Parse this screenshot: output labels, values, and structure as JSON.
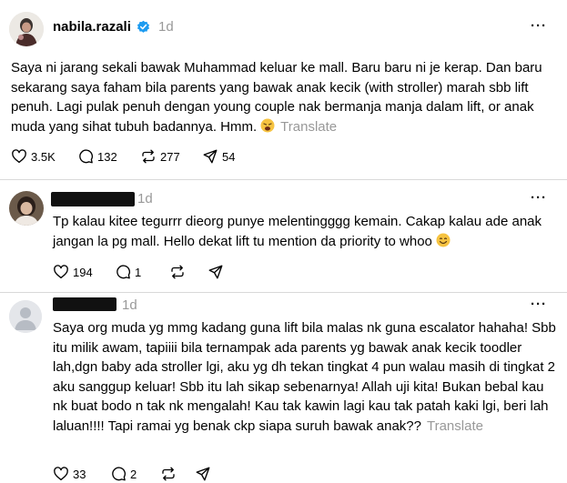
{
  "post": {
    "username": "nabila.razali",
    "time": "1d",
    "more": "···",
    "text": "Saya ni jarang sekali bawak Muhammad keluar ke mall. Baru baru ni je kerap. Dan baru sekarang saya faham bila parents yang bawak anak kecik (with stroller) marah sbb lift penuh. Lagi pulak penuh dengan young couple nak bermanja manja dalam lift, or anak muda yang sihat tubuh badannya. Hmm.",
    "translate": "Translate",
    "likes": "3.5K",
    "comments": "132",
    "reposts": "277",
    "shares": "54"
  },
  "reply1": {
    "time": "1d",
    "more": "···",
    "text": "Tp kalau kitee tegurrr dieorg punye melentingggg kemain. Cakap kalau ade anak jangan la pg mall. Hello dekat lift tu mention da priority to whoo",
    "likes": "194",
    "comments": "1"
  },
  "reply2": {
    "time": "1d",
    "more": "···",
    "text": "Saya org muda yg mmg kadang guna lift bila malas nk guna escalator hahaha! Sbb itu milik awam, tapiiii bila ternampak ada parents yg bawak anak kecik toodler lah,dgn baby ada stroller lgi, aku yg dh tekan tingkat 4 pun walau masih di tingkat 2 aku sanggup keluar! Sbb itu lah sikap sebenarnya! Allah uji kita! Bukan bebal kau nk buat bodo n tak nk mengalah! Kau tak kawin lagi kau tak patah kaki lgi, beri lah laluan!!!! Tapi ramai yg benak ckp siapa suruh bawak anak??",
    "translate": "Translate",
    "likes": "33",
    "comments": "2"
  },
  "colors": {
    "verified": "#1d9bf0",
    "muted": "#999999",
    "divider": "#d9d9d9"
  },
  "icons": [
    "heart-icon",
    "comment-icon",
    "repost-icon",
    "share-icon",
    "verified-badge-icon",
    "more-icon"
  ]
}
